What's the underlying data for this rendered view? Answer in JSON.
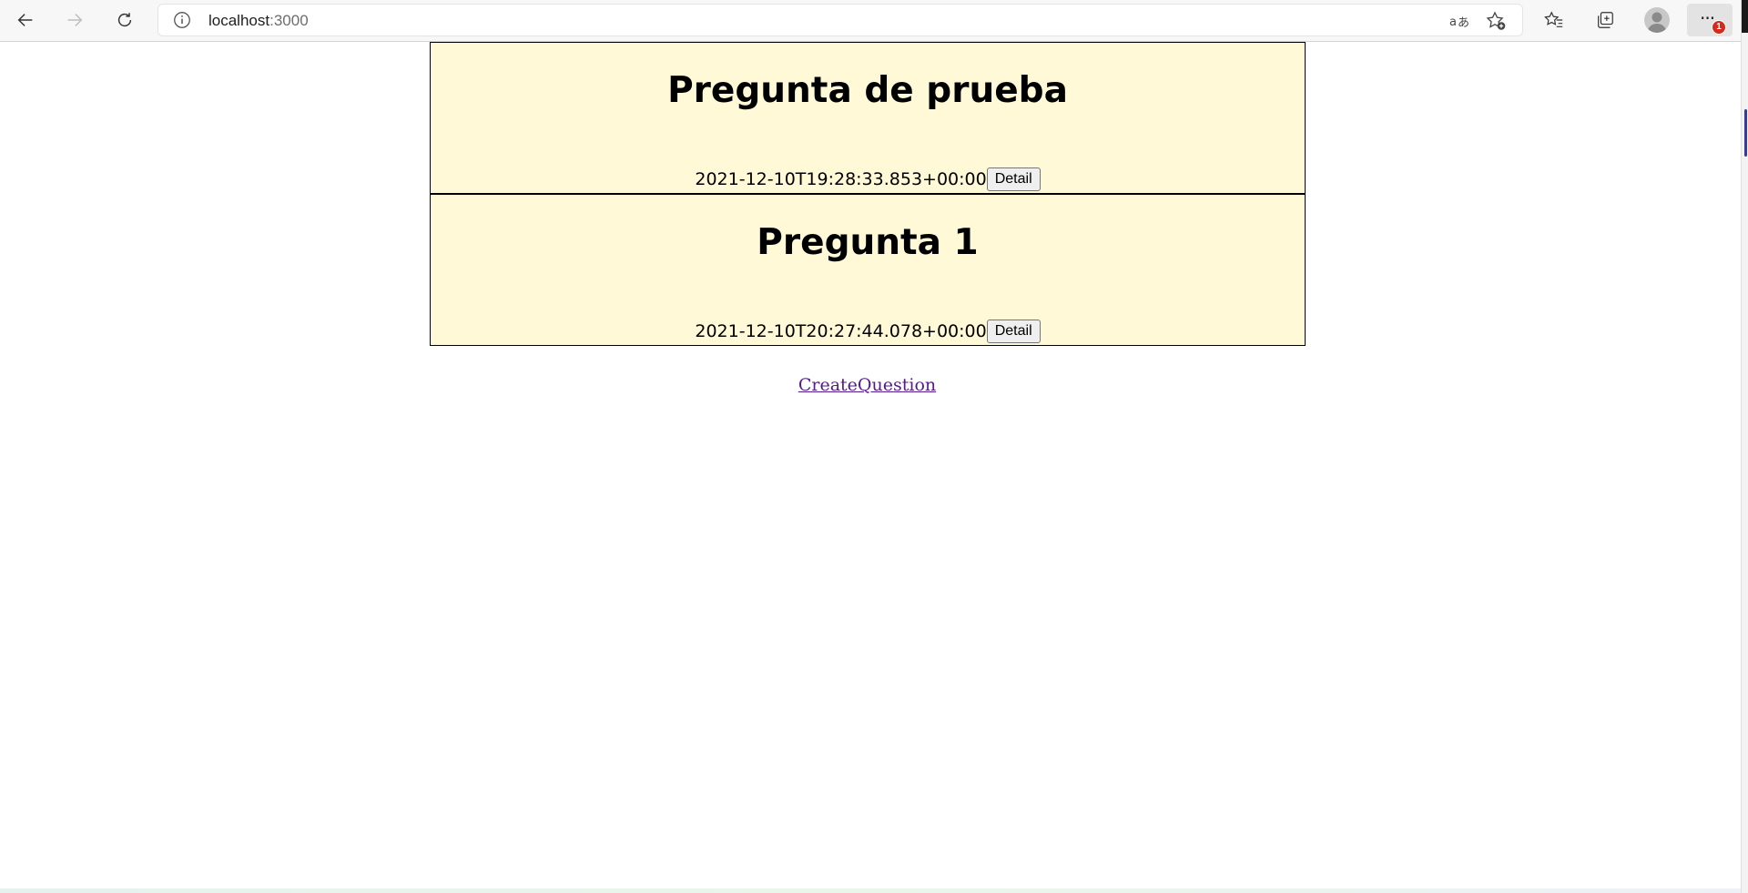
{
  "browser": {
    "url_host": "localhost",
    "url_port": ":3000",
    "more_badge": "1"
  },
  "questions": [
    {
      "title": "Pregunta de prueba",
      "date": "2021-12-10T19:28:33.853+00:00",
      "button": "Detail"
    },
    {
      "title": "Pregunta 1",
      "date": "2021-12-10T20:27:44.078+00:00",
      "button": "Detail"
    }
  ],
  "create_link": "CreateQuestion",
  "colors": {
    "card_background": "#fff9d8",
    "link_visited": "#551a8b"
  },
  "icons": [
    "back-icon",
    "forward-icon",
    "refresh-icon",
    "info-icon",
    "read-aloud-icon",
    "add-favorite-icon",
    "favorites-icon",
    "collections-icon",
    "profile-icon",
    "more-icon"
  ]
}
